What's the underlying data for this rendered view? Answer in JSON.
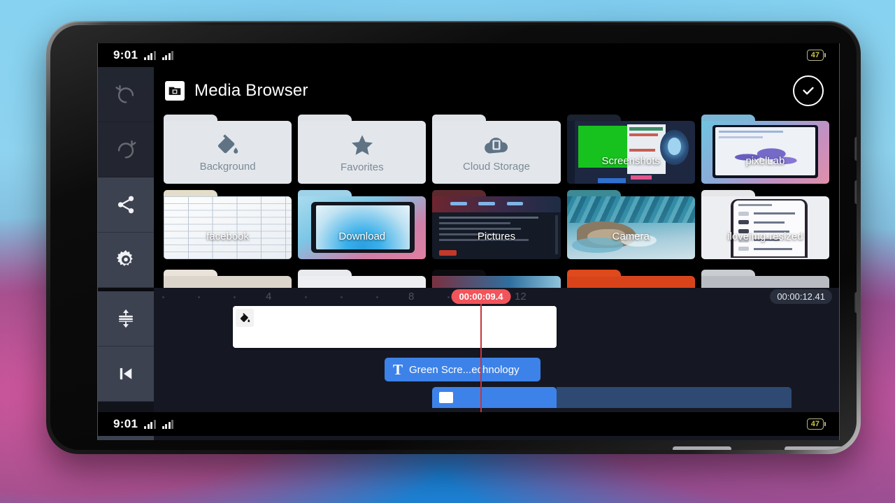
{
  "status_bar": {
    "time": "9:01",
    "battery": "47"
  },
  "rail": {
    "items": [
      {
        "name": "undo",
        "icon": "undo-icon",
        "enabled": false
      },
      {
        "name": "redo",
        "icon": "redo-icon",
        "enabled": false
      },
      {
        "name": "share",
        "icon": "share-icon",
        "enabled": true
      },
      {
        "name": "settings",
        "icon": "gear-icon",
        "enabled": true
      },
      {
        "name": "expand-timeline",
        "icon": "expand-collapse-icon",
        "enabled": true
      },
      {
        "name": "skip-to-start",
        "icon": "skip-previous-icon",
        "enabled": true
      }
    ]
  },
  "browser": {
    "title": "Media Browser",
    "title_icon": "media-browser-icon",
    "done_icon": "check-circle-icon",
    "folders": [
      {
        "label": "Background",
        "icon": "paint-bucket-icon"
      },
      {
        "label": "Favorites",
        "icon": "star-icon"
      },
      {
        "label": "Cloud Storage",
        "icon": "cloud-film-icon"
      }
    ],
    "albums": [
      {
        "label": "Screenshots",
        "thumb": "green-screen-editor"
      },
      {
        "label": "pixelLab",
        "thumb": "world-map-tablet"
      },
      {
        "label": "facebook",
        "thumb": "spreadsheet-table"
      },
      {
        "label": "Download",
        "thumb": "tablet-gradient"
      },
      {
        "label": "Pictures",
        "thumb": "dark-webpage"
      },
      {
        "label": "Camera",
        "thumb": "water-hands-photo"
      },
      {
        "label": "iloveimg-resized",
        "thumb": "phone-list-screenshot"
      }
    ]
  },
  "timeline": {
    "playhead_time": "00:00:09.4",
    "total_time": "00:00:12.41",
    "ruler_ticks": [
      "4",
      "8",
      "12"
    ],
    "background_clip": {
      "icon": "paint-bucket-icon",
      "label": ""
    },
    "text_clip": {
      "icon": "text-tool-icon",
      "glyph": "T",
      "label": "Green Scre...echnology"
    },
    "sticker_clip": {
      "icon": "sticker-icon",
      "label": ""
    }
  },
  "colors": {
    "accent_blue": "#3d82e8",
    "playhead_red": "#f2545b",
    "rail_bg": "#3c4250",
    "timeline_bg": "#151823",
    "battery_text": "#c9c445"
  }
}
